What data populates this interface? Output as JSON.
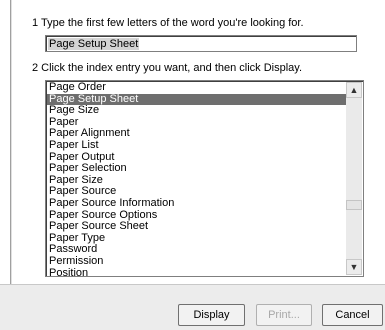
{
  "step1": {
    "label": "1  Type the first few letters of the word you're looking for."
  },
  "search": {
    "value": "Page Setup Sheet"
  },
  "step2": {
    "label": "2  Click the index entry you want, and then click Display."
  },
  "index": {
    "items": [
      "Page Order",
      "Page Setup Sheet",
      "Page Size",
      "Paper",
      "Paper Alignment",
      "Paper List",
      "Paper Output",
      "Paper Selection",
      "Paper Size",
      "Paper Source",
      "Paper Source Information",
      "Paper Source Options",
      "Paper Source Sheet",
      "Paper Type",
      "Password",
      "Permission",
      "Position"
    ],
    "selected_index": 1
  },
  "buttons": {
    "display": "Display",
    "print": "Print...",
    "cancel": "Cancel"
  }
}
